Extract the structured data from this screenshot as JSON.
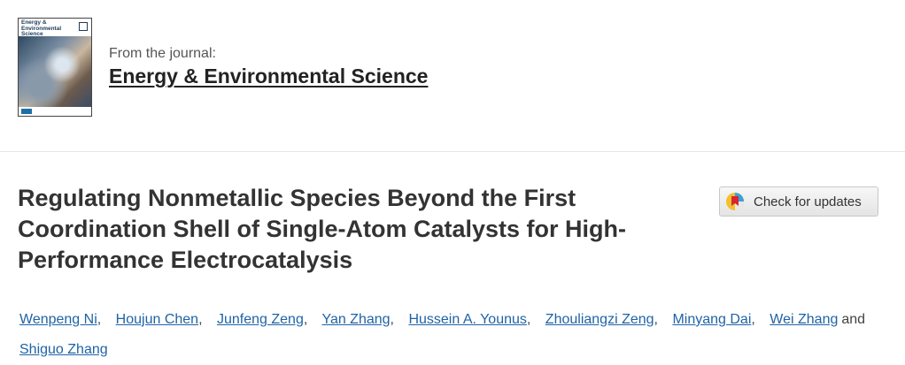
{
  "cover": {
    "title_lines": [
      "Energy &",
      "Environmental",
      "Science"
    ]
  },
  "journal": {
    "label": "From the journal:",
    "name": "Energy & Environmental Science"
  },
  "article": {
    "title": "Regulating Nonmetallic Species Beyond the First Coordination Shell of Single-Atom Catalysts for High-Performance Electrocatalysis"
  },
  "updates_button": {
    "label": "Check for updates"
  },
  "authors": [
    "Wenpeng Ni",
    "Houjun Chen",
    "Junfeng Zeng",
    "Yan Zhang",
    "Hussein A. Younus",
    "Zhouliangzi Zeng",
    "Minyang Dai",
    "Wei Zhang",
    "Shiguo Zhang"
  ],
  "authors_conjunction": "and",
  "separator": ","
}
